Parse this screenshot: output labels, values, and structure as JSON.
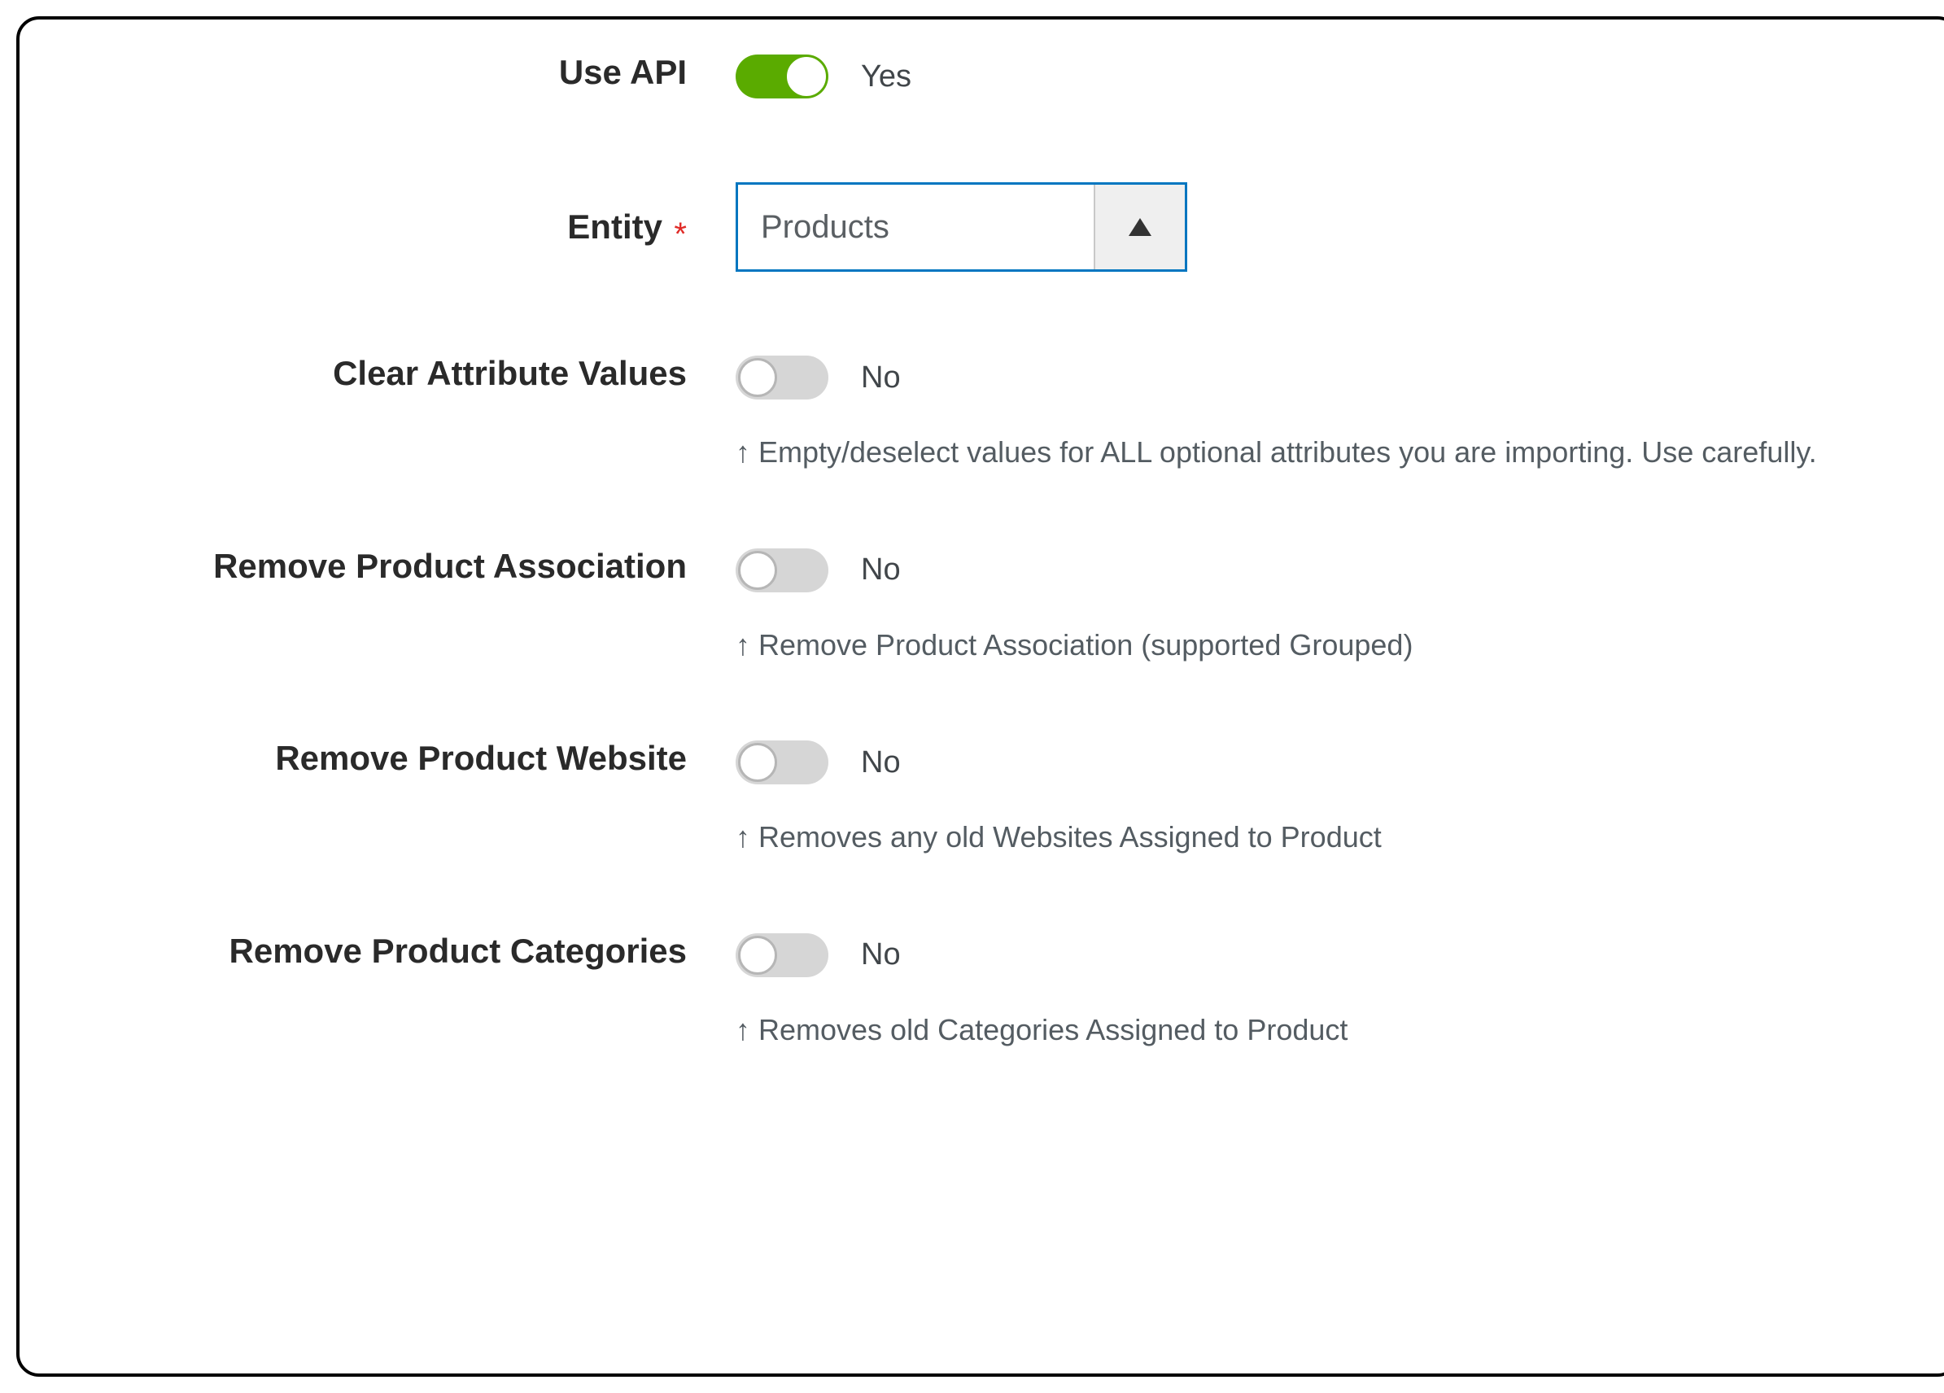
{
  "fields": {
    "use_api": {
      "label": "Use API",
      "value": "Yes"
    },
    "entity": {
      "label": "Entity",
      "value": "Products",
      "required": "*"
    },
    "clear_attr": {
      "label": "Clear Attribute Values",
      "value": "No",
      "hint": "↑ Empty/deselect values for ALL optional attributes you are importing. Use carefully."
    },
    "rm_assoc": {
      "label": "Remove Product Association",
      "value": "No",
      "hint": "↑ Remove Product Association (supported Grouped)"
    },
    "rm_website": {
      "label": "Remove Product Website",
      "value": "No",
      "hint": "↑ Removes any old Websites Assigned to Product"
    },
    "rm_cats": {
      "label": "Remove Product Categories",
      "value": "No",
      "hint": "↑ Removes old Categories Assigned to Product"
    }
  }
}
